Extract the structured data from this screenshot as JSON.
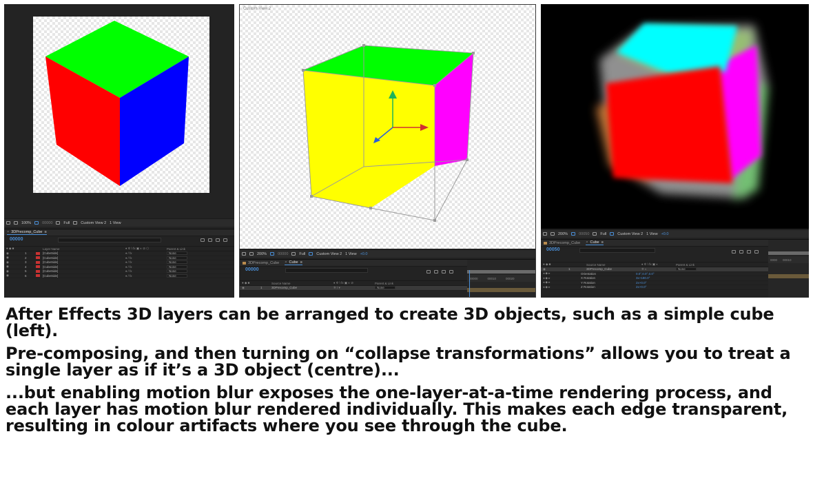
{
  "colors": {
    "face_top": "#00ff00",
    "face_left": "#ff0000",
    "face_right": "#0000ff",
    "face_yellow": "#ffff00",
    "face_magenta": "#ff00ff",
    "face_cyan": "#00ffff",
    "ae_accent": "#4a8fd8"
  },
  "left": {
    "toolbar": {
      "zoom": "100%",
      "time": "00000",
      "resolution": "Full"
    },
    "comp_tab": "3DPrecomp_Cube",
    "timecode": "00000",
    "column_header": "Layer Name",
    "parent_header": "Parent & Link",
    "layers": [
      {
        "num": "1",
        "name": "[CubeSide]",
        "parent": "None"
      },
      {
        "num": "2",
        "name": "[CubeSide]",
        "parent": "None"
      },
      {
        "num": "3",
        "name": "[CubeSide]",
        "parent": "None"
      },
      {
        "num": "4",
        "name": "[CubeSide]",
        "parent": "None"
      },
      {
        "num": "5",
        "name": "[CubeSide]",
        "parent": "None"
      },
      {
        "num": "6",
        "name": "[CubeSide]",
        "parent": "None"
      }
    ],
    "view_menu": "Custom View 2",
    "views_count": "1 View"
  },
  "center": {
    "camera_label": "Custom View 2",
    "toolbar": {
      "zoom": "200%",
      "time": "00000",
      "resolution": "Full",
      "view": "Custom View 2",
      "views_count": "1 View",
      "exposure": "+0.0"
    },
    "tabs": [
      "3DPrecomp_Cube",
      "Cube"
    ],
    "timecode": "00000",
    "column_header": "Source Name",
    "parent_header": "Parent & Link",
    "layer": {
      "num": "1",
      "name": "3DPrecomp_Cube",
      "parent": "None"
    },
    "ruler": [
      "00000",
      "00010",
      "00020",
      "00030"
    ]
  },
  "right": {
    "toolbar": {
      "zoom": "200%",
      "time": "00050",
      "resolution": "Full",
      "view": "Custom View 2",
      "views_count": "1 View",
      "exposure": "+0.0"
    },
    "tabs": [
      "3DPrecomp_Cube",
      "Cube"
    ],
    "timecode": "00050",
    "column_header": "Source Name",
    "parent_header": "Parent & Link",
    "layer": {
      "num": "1",
      "name": "3DPrecomp_Cube",
      "parent": "None"
    },
    "properties": [
      {
        "name": "Orientation",
        "value": "0.0°,0.0°,0.0°"
      },
      {
        "name": "X Rotation",
        "value": "3x+180.0°"
      },
      {
        "name": "Y Rotation",
        "value": "2x+0.0°"
      },
      {
        "name": "Z Rotation",
        "value": "2x+0.0°"
      }
    ],
    "ruler": [
      "0000",
      "00010"
    ]
  },
  "caption": {
    "p1": "After Effects 3D layers can be arranged to create 3D objects, such as a simple cube (left).",
    "p2": "Pre-composing, and then turning on “collapse transformations” allows you to treat a single layer as if it’s a 3D object (centre)...",
    "p3": "...but enabling motion blur exposes the one-layer-at-a-time rendering process, and each layer has motion blur rendered individually. This makes each edge transparent, resulting in colour artifacts where you see through the cube."
  }
}
